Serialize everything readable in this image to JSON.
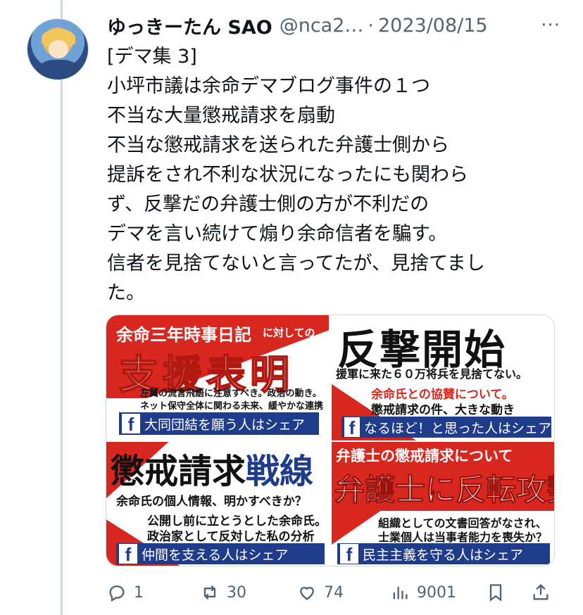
{
  "tweet": {
    "display_name": "ゆっきーたん SAO",
    "handle": "@nca2…",
    "separator": "·",
    "date": "2023/08/15",
    "more": "···",
    "lines": [
      "[デマ集 3]",
      "小坪市議は余命デマブログ事件の１つ",
      "不当な大量懲戒請求を扇動",
      "不当な懲戒請求を送られた弁護士側から",
      "提訴をされ不利な状況になったにも関わら",
      "ず、反撃だの弁護士側の方が不利だの",
      "デマを言い続けて煽り余命信者を騙す。",
      "信者を見捨てないと言ってたが、見捨てまし",
      "た。"
    ]
  },
  "media": {
    "tile1": {
      "top": "余命三年時事日記",
      "top_small": "に対しての",
      "big": "支援表明",
      "sub1": "左翼の流言飛語に注意すべき。政治の動き。",
      "sub2": "ネット保守全体に関わる未来、緩やかな連携",
      "share": "大同団結を願う人はシェア"
    },
    "tile2": {
      "big": "反撃開始",
      "sub1": "援軍に来た６０万将兵を見捨てない。",
      "sub2": "余命氏との協賛について。",
      "sub3": "懲戒請求の件、大きな動き",
      "share": "なるほど！と思った人はシェア"
    },
    "tile3": {
      "big1": "懲戒請求",
      "big2": "戦線",
      "sub1": "余命氏の個人情報、明かすべきか？",
      "sub2": "公開し前に立とうとした余命氏。",
      "sub3": "政治家として反対した私の分析",
      "share": "仲間を支える人はシェア"
    },
    "tile4": {
      "top": "弁護士の懲戒請求について",
      "big": "弁護士に反転攻勢",
      "sub1": "組織としての文書回答がなされ、",
      "sub2": "士業個人は当事者能力を喪失か？",
      "share": "民主主義を守る人はシェア"
    },
    "fb_letter": "f"
  },
  "actions": {
    "reply_count": "1",
    "retweet_count": "30",
    "like_count": "74",
    "view_count": "9001"
  },
  "colors": {
    "text": "#0f1419",
    "secondary": "#536471",
    "red": "#d7271f",
    "navy": "#1f3c8a"
  }
}
